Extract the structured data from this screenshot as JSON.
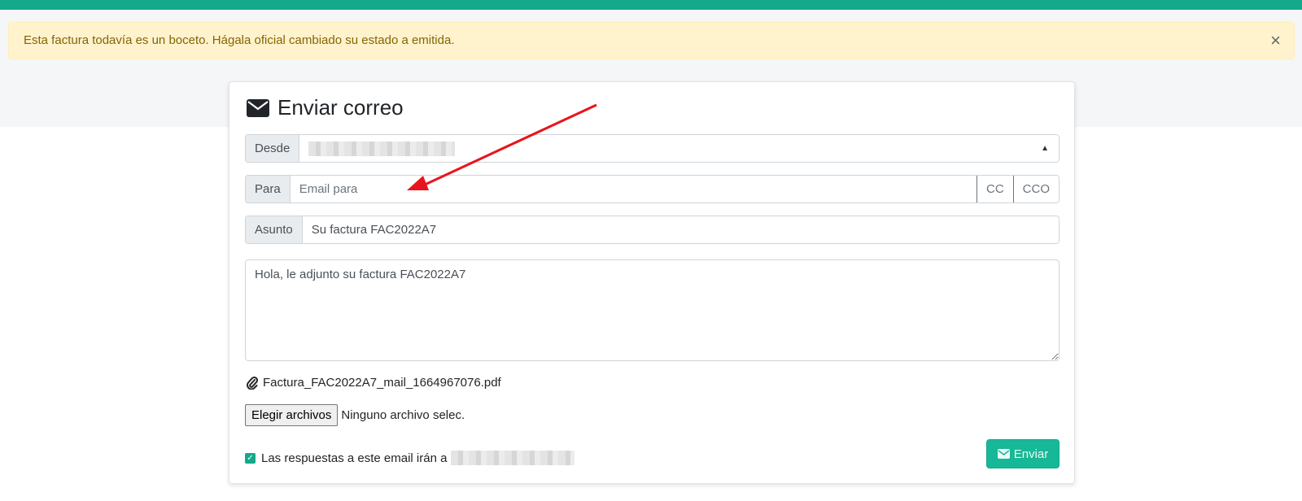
{
  "alert": {
    "message": "Esta factura todavía es un boceto. Hágala oficial cambiado su estado a emitida.",
    "close_glyph": "×"
  },
  "card": {
    "title": "Enviar correo",
    "title_icon": "envelope-icon"
  },
  "from": {
    "label": "Desde",
    "value_redacted": true
  },
  "to": {
    "label": "Para",
    "placeholder": "Email para",
    "cc_label": "CC",
    "bcc_label": "CCO"
  },
  "subject": {
    "label": "Asunto",
    "value": "Su factura FAC2022A7"
  },
  "message": {
    "value": "Hola, le adjunto su factura FAC2022A7"
  },
  "attachment": {
    "icon": "paperclip-icon",
    "filename": "Factura_FAC2022A7_mail_1664967076.pdf"
  },
  "file_input": {
    "button_label": "Elegir archivos",
    "status": "Ninguno archivo selec."
  },
  "reply_to": {
    "checked": true,
    "label": "Las respuestas a este email irán a"
  },
  "send": {
    "label": "Enviar",
    "icon": "envelope-icon"
  },
  "colors": {
    "accent": "#13a98a",
    "alert_bg": "#fff3cd",
    "alert_text": "#856404",
    "annotation_arrow": "#e8141c"
  }
}
